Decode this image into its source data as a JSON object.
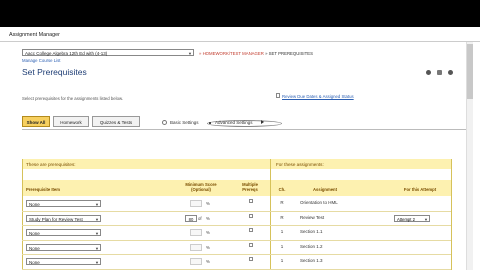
{
  "app": {
    "title": "Assignment Manager"
  },
  "course": {
    "selected": "Aacc College Algebra 12th Ed with (4-13)"
  },
  "breadcrumb": {
    "link": "» HOMEWORK/TEST MANAGER",
    "current": "» SET PREREQUISITES"
  },
  "manage_link": "Manage Course List",
  "page_title": "Set Prerequisites",
  "instructions": "Select prerequisites for the assignments listed below.",
  "review_link": "Review Due Dates & Assigned Status",
  "tabs": [
    "Show All",
    "Homework",
    "Quizzes & Tests"
  ],
  "settings": {
    "basic": "Basic Settings",
    "advanced": "Advanced Settings"
  },
  "table": {
    "section_left": "These are prerequisites:",
    "section_right": "For these assignments:",
    "headers": {
      "prereq": "Prerequisite Item",
      "score": "Minimum Score (Optional)",
      "multiple": "Multiple Prereqs",
      "ch": "Ch.",
      "assignment": "Assignment",
      "attempt": "For this Attempt"
    },
    "rows": [
      {
        "prereq": "None",
        "score": "",
        "ch": "R",
        "assignment": "Orientation to HML",
        "attempt": ""
      },
      {
        "prereq": "Study Plan for Review Test",
        "score": "80",
        "ch": "R",
        "assignment": "Review Test",
        "attempt": "Attempt 2"
      },
      {
        "prereq": "None",
        "score": "",
        "ch": "1",
        "assignment": "Section 1.1",
        "attempt": ""
      },
      {
        "prereq": "None",
        "score": "",
        "ch": "1",
        "assignment": "Section 1.2",
        "attempt": ""
      },
      {
        "prereq": "None",
        "score": "",
        "ch": "1",
        "assignment": "Section 1.3",
        "attempt": ""
      }
    ],
    "percent": "%",
    "of_label": "of"
  }
}
